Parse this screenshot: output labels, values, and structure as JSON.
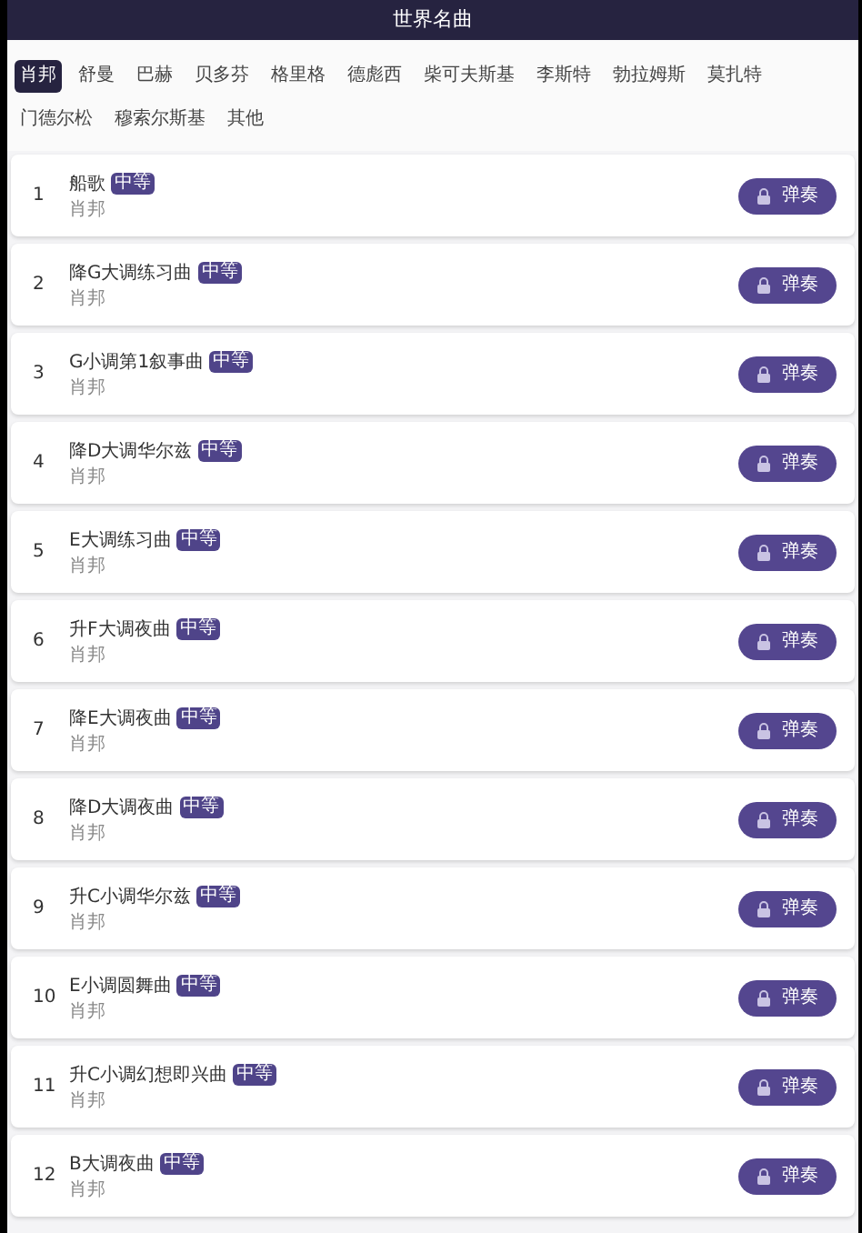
{
  "header": {
    "title": "世界名曲"
  },
  "tabs": [
    {
      "label": "肖邦",
      "selected": true
    },
    {
      "label": "舒曼",
      "selected": false
    },
    {
      "label": "巴赫",
      "selected": false
    },
    {
      "label": "贝多芬",
      "selected": false
    },
    {
      "label": "格里格",
      "selected": false
    },
    {
      "label": "德彪西",
      "selected": false
    },
    {
      "label": "柴可夫斯基",
      "selected": false
    },
    {
      "label": "李斯特",
      "selected": false
    },
    {
      "label": "勃拉姆斯",
      "selected": false
    },
    {
      "label": "莫扎特",
      "selected": false
    },
    {
      "label": "门德尔松",
      "selected": false
    },
    {
      "label": "穆索尔斯基",
      "selected": false
    },
    {
      "label": "其他",
      "selected": false
    }
  ],
  "songs": [
    {
      "number": "1",
      "title": "船歌",
      "difficulty": "中等",
      "composer": "肖邦",
      "action": "弹奏",
      "locked": true
    },
    {
      "number": "2",
      "title": "降G大调练习曲",
      "difficulty": "中等",
      "composer": "肖邦",
      "action": "弹奏",
      "locked": true
    },
    {
      "number": "3",
      "title": "G小调第1叙事曲",
      "difficulty": "中等",
      "composer": "肖邦",
      "action": "弹奏",
      "locked": true
    },
    {
      "number": "4",
      "title": "降D大调华尔兹",
      "difficulty": "中等",
      "composer": "肖邦",
      "action": "弹奏",
      "locked": true
    },
    {
      "number": "5",
      "title": "E大调练习曲",
      "difficulty": "中等",
      "composer": "肖邦",
      "action": "弹奏",
      "locked": true
    },
    {
      "number": "6",
      "title": "升F大调夜曲",
      "difficulty": "中等",
      "composer": "肖邦",
      "action": "弹奏",
      "locked": true
    },
    {
      "number": "7",
      "title": "降E大调夜曲",
      "difficulty": "中等",
      "composer": "肖邦",
      "action": "弹奏",
      "locked": true
    },
    {
      "number": "8",
      "title": "降D大调夜曲",
      "difficulty": "中等",
      "composer": "肖邦",
      "action": "弹奏",
      "locked": true
    },
    {
      "number": "9",
      "title": "升C小调华尔兹",
      "difficulty": "中等",
      "composer": "肖邦",
      "action": "弹奏",
      "locked": true
    },
    {
      "number": "10",
      "title": "E小调圆舞曲",
      "difficulty": "中等",
      "composer": "肖邦",
      "action": "弹奏",
      "locked": true
    },
    {
      "number": "11",
      "title": "升C小调幻想即兴曲",
      "difficulty": "中等",
      "composer": "肖邦",
      "action": "弹奏",
      "locked": true
    },
    {
      "number": "12",
      "title": "B大调夜曲",
      "difficulty": "中等",
      "composer": "肖邦",
      "action": "弹奏",
      "locked": true
    }
  ]
}
